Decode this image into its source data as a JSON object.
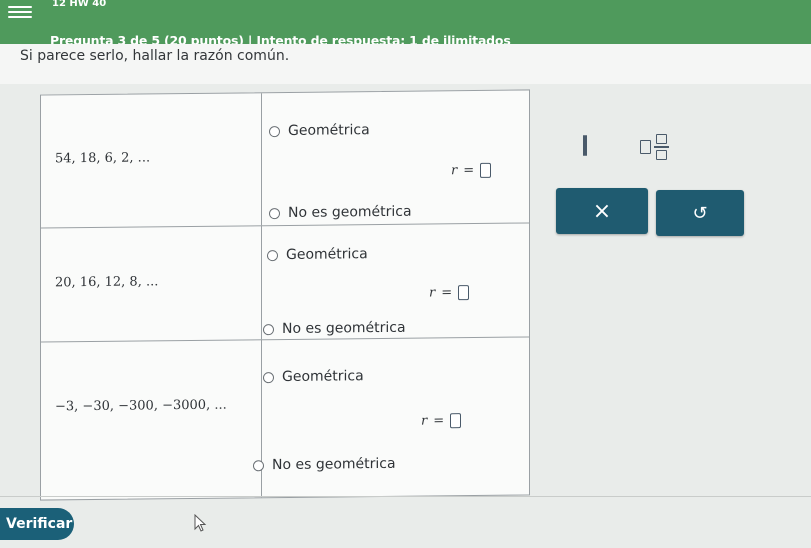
{
  "header": {
    "hw_label": "12 HW 40",
    "question_line": "Pregunta 3 de 5 (20 puntos)  |  Intento de respuesta: 1 de ilimitados"
  },
  "prompt": "Si parece serlo, hallar la razón común.",
  "rows": [
    {
      "sequence": "54, 18, 6, 2, ...",
      "option_geo": "Geométrica",
      "r_label": "r",
      "equals": "=",
      "option_not": "No es geométrica"
    },
    {
      "sequence": "20, 16, 12, 8, ...",
      "option_geo": "Geométrica",
      "r_label": "r",
      "equals": "=",
      "option_not": "No es geométrica"
    },
    {
      "sequence": "−3, −30, −300, −3000, ...",
      "option_geo": "Geométrica",
      "r_label": "r",
      "equals": "=",
      "option_not": "No es geométrica"
    }
  ],
  "palette": {
    "fraction_icon": "fraction-template-icon",
    "mixed_icon": "mixed-number-template-icon",
    "clear_label": "×",
    "undo_label": "↺"
  },
  "verify_label": "Verificar",
  "colors": {
    "header_green": "#4f9a5c",
    "button_teal": "#1f5b70"
  }
}
